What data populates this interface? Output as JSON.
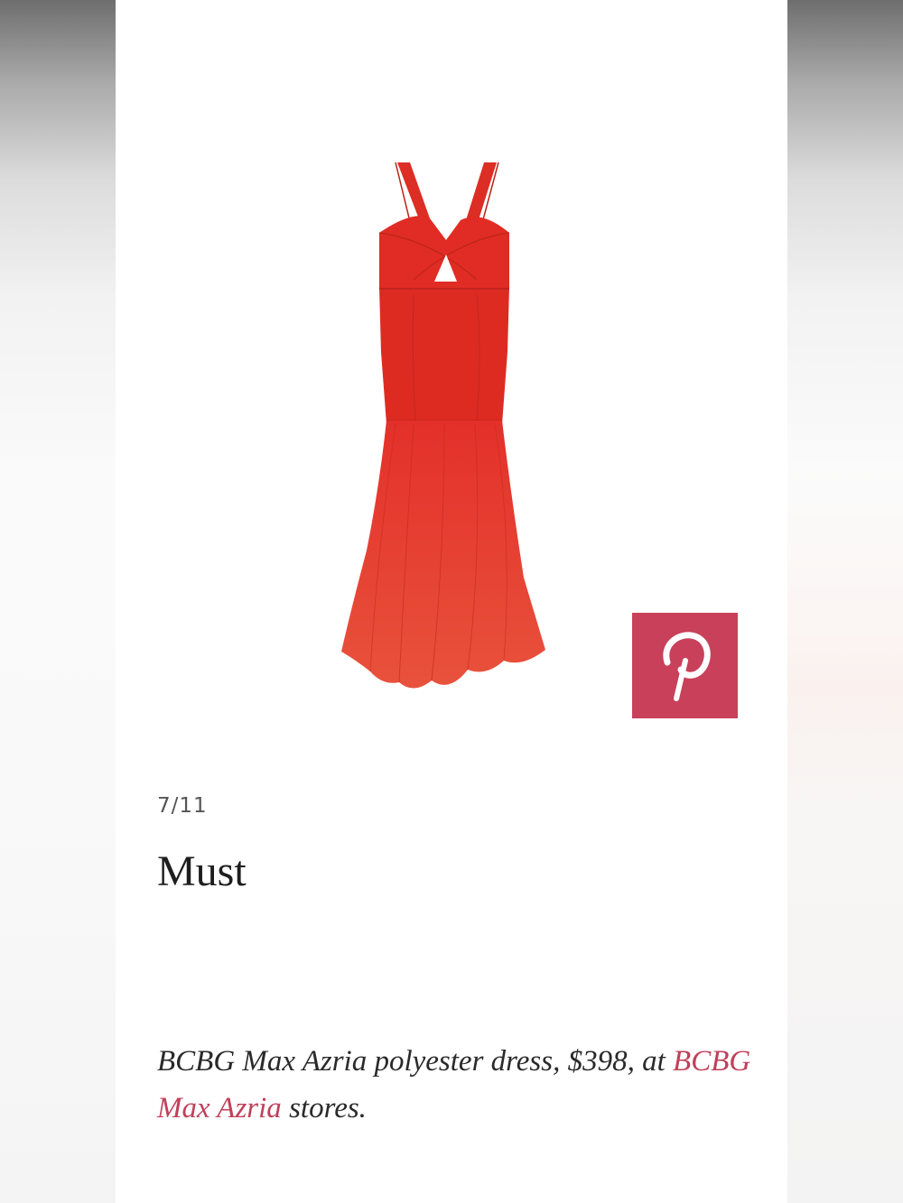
{
  "slide": {
    "counter": "7/11",
    "title": "Must"
  },
  "product": {
    "image_alt": "Red BCBG Max Azria halter gown with cutout",
    "caption_before": "BCBG Max Azria polyester dress, $398, at",
    "caption_link": "BCBG Max Azria",
    "caption_after": "stores."
  },
  "share": {
    "pinterest_label": "Pin it",
    "pinterest_color": "#c8405a"
  },
  "colors": {
    "dress": "#e03628",
    "link": "#c0405a",
    "title": "#1e1e1e"
  }
}
